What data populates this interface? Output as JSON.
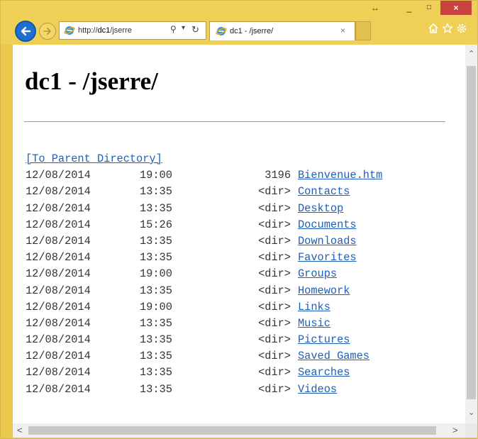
{
  "window": {
    "resize_glyph": "↔",
    "minimize_glyph": "_",
    "maximize_glyph": "□",
    "close_glyph": "×"
  },
  "nav": {
    "address_prefix": "http://",
    "address_host": "dc1",
    "address_path": "/jserre",
    "search_glyph": "⚲",
    "dropdown_glyph": "▾",
    "refresh_glyph": "↻"
  },
  "tab": {
    "title": "dc1 - /jserre/",
    "close_glyph": "×"
  },
  "page": {
    "title": "dc1 - /jserre/",
    "parent_link": "[To Parent Directory]",
    "entries": [
      {
        "date": "12/08/2014",
        "time": "19:00",
        "size": "3196",
        "name": "Bienvenue.htm"
      },
      {
        "date": "12/08/2014",
        "time": "13:35",
        "size": "<dir>",
        "name": "Contacts"
      },
      {
        "date": "12/08/2014",
        "time": "13:35",
        "size": "<dir>",
        "name": "Desktop"
      },
      {
        "date": "12/08/2014",
        "time": "15:26",
        "size": "<dir>",
        "name": "Documents"
      },
      {
        "date": "12/08/2014",
        "time": "13:35",
        "size": "<dir>",
        "name": "Downloads"
      },
      {
        "date": "12/08/2014",
        "time": "13:35",
        "size": "<dir>",
        "name": "Favorites"
      },
      {
        "date": "12/08/2014",
        "time": "19:00",
        "size": "<dir>",
        "name": "Groups"
      },
      {
        "date": "12/08/2014",
        "time": "13:35",
        "size": "<dir>",
        "name": "Homework"
      },
      {
        "date": "12/08/2014",
        "time": "19:00",
        "size": "<dir>",
        "name": "Links"
      },
      {
        "date": "12/08/2014",
        "time": "13:35",
        "size": "<dir>",
        "name": "Music"
      },
      {
        "date": "12/08/2014",
        "time": "13:35",
        "size": "<dir>",
        "name": "Pictures"
      },
      {
        "date": "12/08/2014",
        "time": "13:35",
        "size": "<dir>",
        "name": "Saved Games"
      },
      {
        "date": "12/08/2014",
        "time": "13:35",
        "size": "<dir>",
        "name": "Searches"
      },
      {
        "date": "12/08/2014",
        "time": "13:35",
        "size": "<dir>",
        "name": "Videos"
      }
    ]
  },
  "scrollbars": {
    "up": "⌃",
    "down": "⌄",
    "left": "<",
    "right": ">"
  },
  "colors": {
    "chrome": "#efcf55",
    "link": "#1f5fb8",
    "back_button": "#1d6fd1",
    "close_button": "#c8433d"
  }
}
